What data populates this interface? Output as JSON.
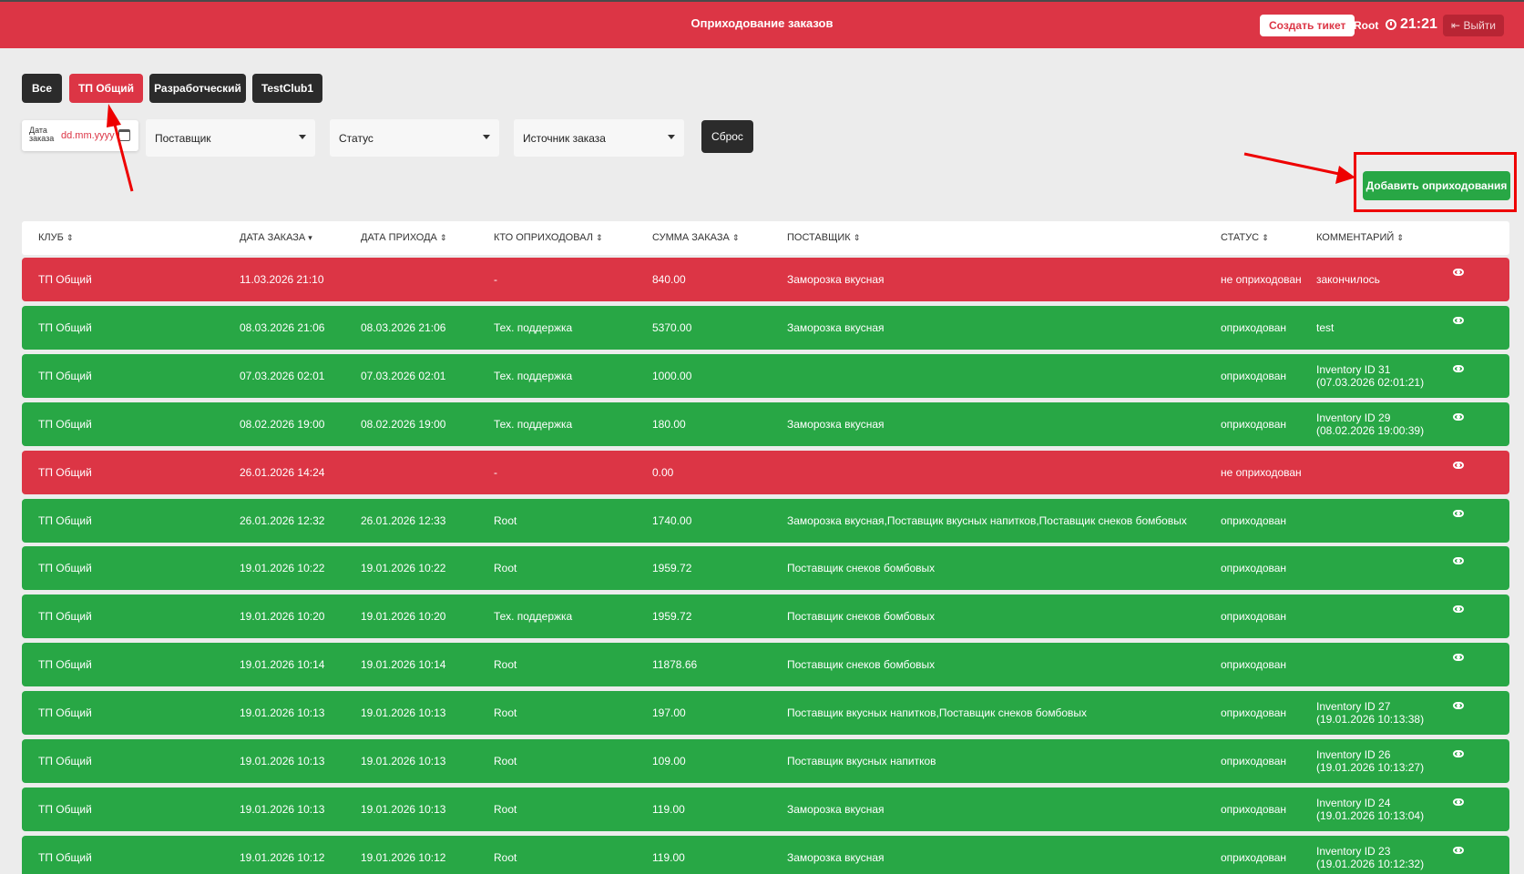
{
  "header": {
    "title": "Оприходование заказов",
    "create_ticket": "Создать тикет",
    "user": "Root",
    "time": "21:21",
    "logout": "Выйти"
  },
  "tabs": [
    "Все",
    "ТП Общий",
    "Разработческий",
    "TestClub1"
  ],
  "active_tab": "ТП Общий",
  "filters": {
    "date_label": "Дата заказа",
    "date_placeholder": "dd.mm.yyyy",
    "supplier": "Поставщик",
    "status": "Статус",
    "source": "Источник заказа",
    "reset": "Сброс"
  },
  "add_button": "Добавить оприходования",
  "table": {
    "columns": [
      "КЛУБ",
      "ДАТА ЗАКАЗА",
      "ДАТА ПРИХОДА",
      "КТО ОПРИХОДОВАЛ",
      "СУММА ЗАКАЗА",
      "ПОСТАВЩИК",
      "СТАТУС",
      "КОММЕНТАРИЙ"
    ],
    "rows": [
      {
        "status_color": "red",
        "club": "ТП Общий",
        "order_date": "11.03.2026 21:10",
        "arrival_date": "",
        "who": "-",
        "sum": "840.00",
        "supplier": "Заморозка вкусная",
        "status": "не оприходован",
        "comment": "закончилось"
      },
      {
        "status_color": "green",
        "club": "ТП Общий",
        "order_date": "08.03.2026 21:06",
        "arrival_date": "08.03.2026 21:06",
        "who": "Тех. поддержка",
        "sum": "5370.00",
        "supplier": "Заморозка вкусная",
        "status": "оприходован",
        "comment": "test"
      },
      {
        "status_color": "green",
        "club": "ТП Общий",
        "order_date": "07.03.2026 02:01",
        "arrival_date": "07.03.2026 02:01",
        "who": "Тех. поддержка",
        "sum": "1000.00",
        "supplier": "",
        "status": "оприходован",
        "comment": "Inventory ID 31 (07.03.2026 02:01:21)"
      },
      {
        "status_color": "green",
        "club": "ТП Общий",
        "order_date": "08.02.2026 19:00",
        "arrival_date": "08.02.2026 19:00",
        "who": "Тех. поддержка",
        "sum": "180.00",
        "supplier": "Заморозка вкусная",
        "status": "оприходован",
        "comment": "Inventory ID 29 (08.02.2026 19:00:39)"
      },
      {
        "status_color": "red",
        "club": "ТП Общий",
        "order_date": "26.01.2026 14:24",
        "arrival_date": "",
        "who": "-",
        "sum": "0.00",
        "supplier": "",
        "status": "не оприходован",
        "comment": ""
      },
      {
        "status_color": "green",
        "club": "ТП Общий",
        "order_date": "26.01.2026 12:32",
        "arrival_date": "26.01.2026 12:33",
        "who": "Root",
        "sum": "1740.00",
        "supplier": "Заморозка вкусная,Поставщик вкусных напитков,Поставщик снеков бомбовых",
        "status": "оприходован",
        "comment": ""
      },
      {
        "status_color": "green",
        "club": "ТП Общий",
        "order_date": "19.01.2026 10:22",
        "arrival_date": "19.01.2026 10:22",
        "who": "Root",
        "sum": "1959.72",
        "supplier": "Поставщик снеков бомбовых",
        "status": "оприходован",
        "comment": ""
      },
      {
        "status_color": "green",
        "club": "ТП Общий",
        "order_date": "19.01.2026 10:20",
        "arrival_date": "19.01.2026 10:20",
        "who": "Тех. поддержка",
        "sum": "1959.72",
        "supplier": "Поставщик снеков бомбовых",
        "status": "оприходован",
        "comment": ""
      },
      {
        "status_color": "green",
        "club": "ТП Общий",
        "order_date": "19.01.2026 10:14",
        "arrival_date": "19.01.2026 10:14",
        "who": "Root",
        "sum": "11878.66",
        "supplier": "Поставщик снеков бомбовых",
        "status": "оприходован",
        "comment": ""
      },
      {
        "status_color": "green",
        "club": "ТП Общий",
        "order_date": "19.01.2026 10:13",
        "arrival_date": "19.01.2026 10:13",
        "who": "Root",
        "sum": "197.00",
        "supplier": "Поставщик вкусных напитков,Поставщик снеков бомбовых",
        "status": "оприходован",
        "comment": "Inventory ID 27 (19.01.2026 10:13:38)"
      },
      {
        "status_color": "green",
        "club": "ТП Общий",
        "order_date": "19.01.2026 10:13",
        "arrival_date": "19.01.2026 10:13",
        "who": "Root",
        "sum": "109.00",
        "supplier": "Поставщик вкусных напитков",
        "status": "оприходован",
        "comment": "Inventory ID 26 (19.01.2026 10:13:27)"
      },
      {
        "status_color": "green",
        "club": "ТП Общий",
        "order_date": "19.01.2026 10:13",
        "arrival_date": "19.01.2026 10:13",
        "who": "Root",
        "sum": "119.00",
        "supplier": "Заморозка вкусная",
        "status": "оприходован",
        "comment": "Inventory ID 24 (19.01.2026 10:13:04)"
      },
      {
        "status_color": "green",
        "club": "ТП Общий",
        "order_date": "19.01.2026 10:12",
        "arrival_date": "19.01.2026 10:12",
        "who": "Root",
        "sum": "119.00",
        "supplier": "Заморозка вкусная",
        "status": "оприходован",
        "comment": "Inventory ID 23 (19.01.2026 10:12:32)"
      }
    ]
  },
  "colors": {
    "brand_red": "#dc3545",
    "ok_green": "#28a745",
    "dark": "#2b2b2b"
  }
}
